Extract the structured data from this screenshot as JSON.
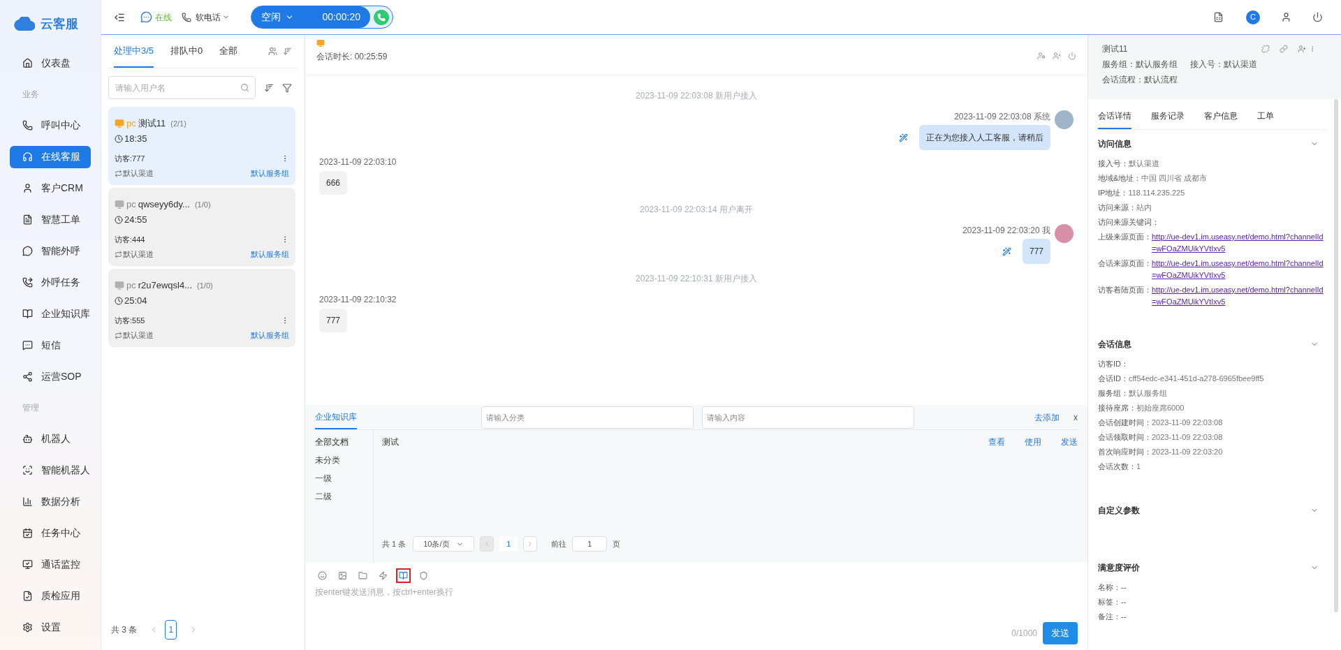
{
  "brand": {
    "name": "云客服"
  },
  "sidebar": {
    "items": [
      {
        "kind": "link",
        "label": "仪表盘",
        "selected": false
      },
      {
        "kind": "section",
        "label": "业务"
      },
      {
        "kind": "link",
        "label": "呼叫中心",
        "selected": false
      },
      {
        "kind": "link",
        "label": "在线客服",
        "selected": true
      },
      {
        "kind": "link",
        "label": "客户CRM",
        "selected": false
      },
      {
        "kind": "link",
        "label": "智慧工单",
        "selected": false
      },
      {
        "kind": "link",
        "label": "智能外呼",
        "selected": false
      },
      {
        "kind": "link",
        "label": "外呼任务",
        "selected": false
      },
      {
        "kind": "link",
        "label": "企业知识库",
        "selected": false
      },
      {
        "kind": "link",
        "label": "短信",
        "selected": false
      },
      {
        "kind": "link",
        "label": "运营SOP",
        "selected": false
      },
      {
        "kind": "section",
        "label": "管理"
      },
      {
        "kind": "link",
        "label": "机器人",
        "selected": false
      },
      {
        "kind": "link",
        "label": "智能机器人",
        "selected": false
      },
      {
        "kind": "link",
        "label": "数据分析",
        "selected": false
      },
      {
        "kind": "link",
        "label": "任务中心",
        "selected": false
      },
      {
        "kind": "link",
        "label": "通话监控",
        "selected": false
      },
      {
        "kind": "link",
        "label": "质检应用",
        "selected": false
      },
      {
        "kind": "link",
        "label": "设置",
        "selected": false
      }
    ]
  },
  "top_bar": {
    "online_status": "在线",
    "phone_mode": "软电话",
    "agent_state": "空闲",
    "call_timer": "00:00:20",
    "avatar_letter": "C"
  },
  "session_list": {
    "tabs": [
      {
        "label": "处理中3/5",
        "selected": true
      },
      {
        "label": "排队中0",
        "selected": false
      },
      {
        "label": "全部",
        "selected": false
      }
    ],
    "search": {
      "placeholder": "请输入用户名"
    },
    "sessions": [
      {
        "device": "pc",
        "name": "测试11",
        "counts": "(2/1)",
        "time": "18:35",
        "visitor": "访客:777",
        "channel": "默认渠道",
        "group": "默认服务组",
        "selected": true,
        "online": true
      },
      {
        "device": "pc",
        "name": "qwseyy6dy...",
        "counts": "(1/0)",
        "time": "24:55",
        "visitor": "访客:444",
        "channel": "默认渠道",
        "group": "默认服务组",
        "selected": false,
        "online": false
      },
      {
        "device": "pc",
        "name": "r2u7ewqsl4...",
        "counts": "(1/0)",
        "time": "25:04",
        "visitor": "访客:555",
        "channel": "默认渠道",
        "group": "默认服务组",
        "selected": false,
        "online": false
      }
    ],
    "total": "共 3 条",
    "page": "1"
  },
  "chat": {
    "duration": "会话时长: 00:25:59",
    "messages": [
      {
        "kind": "system",
        "text": "2023-11-09 22:03:08 新用户接入"
      },
      {
        "kind": "agent",
        "meta": "2023-11-09 22:03:08 系统",
        "text": "正在为您接入人工客服，请稍后",
        "color": "#9fb4c8"
      },
      {
        "kind": "visitor",
        "meta": "2023-11-09 22:03:10",
        "text": "666"
      },
      {
        "kind": "system",
        "text": "2023-11-09 22:03:14 用户离开"
      },
      {
        "kind": "agent",
        "meta": "2023-11-09 22:03:20 我",
        "text": "777",
        "color": "#d98fa5"
      },
      {
        "kind": "system",
        "text": "2023-11-09 22:10:31 新用户接入"
      },
      {
        "kind": "visitor",
        "meta": "2023-11-09 22:10:32",
        "text": "777"
      }
    ],
    "knowledge": {
      "tab": "企业知识库",
      "category_placeholder": "请输入分类",
      "content_placeholder": "请输入内容",
      "add": "去添加",
      "close": "x",
      "categories": [
        {
          "label": "全部文档",
          "selected": true
        },
        {
          "label": "未分类",
          "selected": false
        },
        {
          "label": "一级",
          "selected": false
        },
        {
          "label": "二级",
          "selected": false
        }
      ],
      "docs": [
        {
          "title": "测试",
          "actions": [
            "查看",
            "使用",
            "发送"
          ]
        }
      ],
      "total": "共 1 条",
      "page_size": "10条/页",
      "page": "1",
      "goto": "前往",
      "goto_value": "1",
      "page_unit": "页"
    },
    "toolbar": [
      {
        "kind": "emoji",
        "selected": false
      },
      {
        "kind": "image",
        "selected": false
      },
      {
        "kind": "file",
        "selected": false
      },
      {
        "kind": "quick",
        "selected": false
      },
      {
        "kind": "book",
        "selected": true
      },
      {
        "kind": "shield",
        "selected": false
      }
    ],
    "input": {
      "placeholder": "按enter键发送消息，按ctrl+enter换行",
      "counter": "0/1000",
      "send": "发送"
    }
  },
  "detail": {
    "name": "测试11",
    "service_group": "服务组：默认服务组",
    "access": "接入号：默认渠道",
    "flow": "会话流程：默认流程",
    "tabs": [
      {
        "label": "会话详情",
        "selected": true
      },
      {
        "label": "服务记录",
        "selected": false
      },
      {
        "label": "客户信息",
        "selected": false
      },
      {
        "label": "工单",
        "selected": false
      }
    ],
    "sections": [
      {
        "title": "访问信息",
        "rows": [
          {
            "label": "接入号：",
            "value": "默认渠道",
            "kind": "text"
          },
          {
            "label": "地域&地址：",
            "value": "中国 四川省 成都市",
            "kind": "text"
          },
          {
            "label": "IP地址：",
            "value": "118.114.235.225",
            "kind": "text"
          },
          {
            "label": "访问来源：",
            "value": "站内",
            "kind": "text"
          },
          {
            "label": "访问来源关键词："
          },
          {
            "label": "上级来源页面：",
            "value": "http://ue-dev1.im.useasy.net/demo.html?channelId=wFOaZMUikYVtIxv5",
            "kind": "link"
          },
          {
            "label": "会话来源页面：",
            "value": "http://ue-dev1.im.useasy.net/demo.html?channelId=wFOaZMUikYVtIxv5",
            "kind": "link"
          },
          {
            "label": "访客着陆页面：",
            "value": "http://ue-dev1.im.useasy.net/demo.html?channelId=wFOaZMUikYVtIxv5",
            "kind": "link"
          }
        ]
      },
      {
        "title": "会话信息",
        "rows": [
          {
            "label": "访客ID："
          },
          {
            "label": "会话ID：",
            "value": "cff54edc-e341-451d-a278-6965fbee9ff5",
            "kind": "text"
          },
          {
            "label": "服务组：",
            "value": "默认服务组",
            "kind": "text"
          },
          {
            "label": "接待座席：",
            "value": "初始座席6000",
            "kind": "text"
          },
          {
            "label": "会话创建时间：",
            "value": "2023-11-09 22:03:08",
            "kind": "text"
          },
          {
            "label": "会话领取时间：",
            "value": "2023-11-09 22:03:08",
            "kind": "text"
          },
          {
            "label": "首次响应时间：",
            "value": "2023-11-09 22:03:20",
            "kind": "text"
          },
          {
            "label": "会话次数：",
            "value": "1",
            "kind": "text"
          }
        ]
      },
      {
        "title": "自定义参数"
      },
      {
        "title": "满意度评价",
        "rows": [
          {
            "label": "名称：--"
          },
          {
            "label": "标签：--"
          },
          {
            "label": "备注：--"
          }
        ]
      }
    ]
  }
}
